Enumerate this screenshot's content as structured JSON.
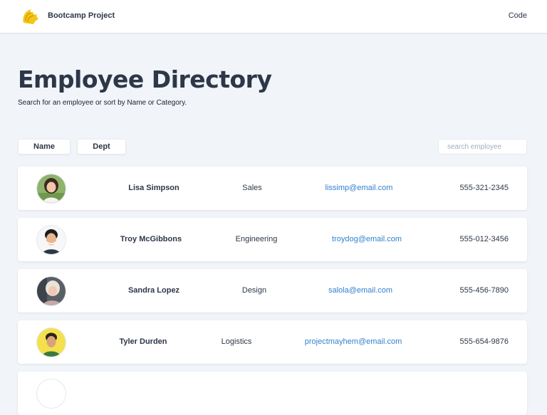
{
  "navbar": {
    "logo_icon": "knight-helmet-logo",
    "brand": "Bootcamp Project",
    "link": "Code"
  },
  "header": {
    "title": "Employee Directory",
    "subtitle": "Search for an employee or sort by Name or Category."
  },
  "controls": {
    "sort_name_label": "Name",
    "sort_dept_label": "Dept",
    "search_placeholder": "search employee",
    "search_value": ""
  },
  "colors": {
    "background": "#f1f4f8",
    "text": "#2d3748",
    "link": "#3182ce",
    "logo": "#f5c518"
  },
  "employees": [
    {
      "name": "Lisa Simpson",
      "dept": "Sales",
      "email": "lissimp@email.com",
      "phone": "555-321-2345"
    },
    {
      "name": "Troy McGibbons",
      "dept": "Engineering",
      "email": "troydog@email.com",
      "phone": "555-012-3456"
    },
    {
      "name": "Sandra Lopez",
      "dept": "Design",
      "email": "salola@email.com",
      "phone": "555-456-7890"
    },
    {
      "name": "Tyler Durden",
      "dept": "Logistics",
      "email": "projectmayhem@email.com",
      "phone": "555-654-9876"
    },
    {
      "name": "",
      "dept": "",
      "email": "",
      "phone": ""
    }
  ]
}
